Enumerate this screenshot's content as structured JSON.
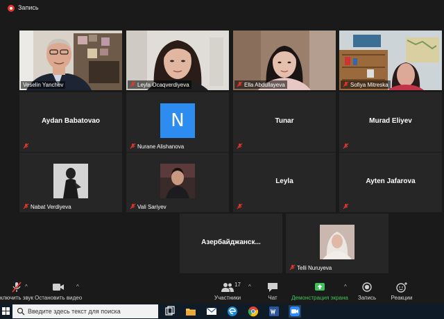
{
  "recording": {
    "label": "Запись"
  },
  "participants": {
    "veselin": "Veselin Yanchev",
    "leyla_o": "Leyla Ocaqverdiyeva",
    "ella": "Ella Abdullayeva",
    "sofiya": "Sofiya Mitreska",
    "aydan": "Aydan Babatovao",
    "nurane": "Nurane Alishanova",
    "nurane_initial": "N",
    "tunar": "Tunar",
    "murad": "Murad Eliyev",
    "nabat": "Nabat Verdiyeva",
    "vali": "Vali Sariyev",
    "leyla": "Leyla",
    "ayten": "Ayten Jafarova",
    "azerb": "Азербайджанск...",
    "telli": "Telli Nuruyeva"
  },
  "toolbar": {
    "mute": "ключить звук",
    "stop_video": "Остановить видео",
    "participants": "Участники",
    "participants_count": "17",
    "chat": "Чат",
    "share": "Демонстрация экрана",
    "record": "Запись",
    "reactions": "Реакции"
  },
  "taskbar": {
    "search_placeholder": "Введите здесь текст для поиска"
  },
  "colors": {
    "active_speaker": "#c9e44a",
    "share_green": "#3ec45a",
    "muted_red": "#e8362d",
    "avatar_blue": "#2d8cf0"
  }
}
